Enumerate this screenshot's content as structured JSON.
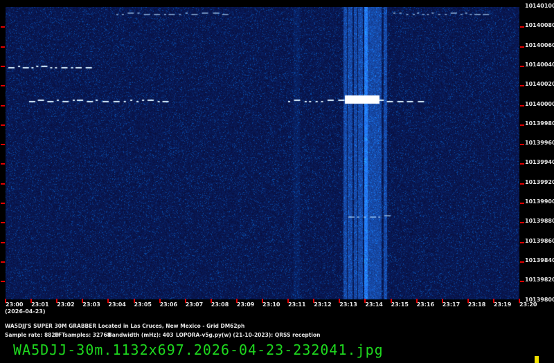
{
  "y_axis": {
    "labels": [
      "10140100",
      "10140080",
      "10140060",
      "10140040",
      "10140020",
      "10140000",
      "10139980",
      "10139960",
      "10139940",
      "10139920",
      "10139900",
      "10139880",
      "10139860",
      "10139840",
      "10139820",
      "10139800"
    ]
  },
  "x_axis": {
    "labels": [
      "23:00",
      "23:01",
      "23:02",
      "23:03",
      "23:04",
      "23:05",
      "23:06",
      "23:07",
      "23:08",
      "23:09",
      "23:10",
      "23:11",
      "23:12",
      "23:13",
      "23:14",
      "23:15",
      "23:16",
      "23:17",
      "23:18",
      "23:19",
      "23:20"
    ],
    "date": "(2026-04-23)"
  },
  "info": {
    "line1": "WA5DJJ'S SUPER 30M GRABBER Located in Las Cruces, New Mexico - Grid DM62ph",
    "sample_rate": "Sample rate: 8820",
    "fft": "FFTsamples: 32768",
    "bandwidth": "Bandwidth (mHz): 403",
    "software": "LOPORA-v5g.py(w) (21-10-2023): QRSS reception"
  },
  "filename": "WA5DJJ-30m.1132x697.2026-04-23-232041.jpg",
  "colors": {
    "background": "#000000",
    "waterfall": "#0a1450",
    "tick": "#e00000",
    "filename": "#1ed81e"
  }
}
